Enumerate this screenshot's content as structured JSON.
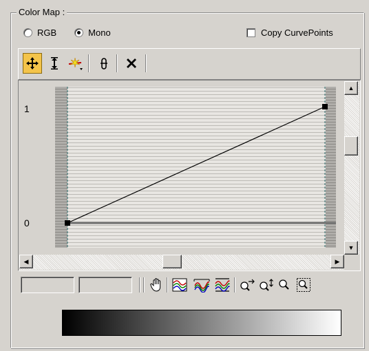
{
  "group": {
    "title": "Color Map :"
  },
  "mode": {
    "options": [
      {
        "label": "RGB",
        "selected": false
      },
      {
        "label": "Mono",
        "selected": true
      }
    ]
  },
  "copy_curve_points": {
    "label": "Copy CurvePoints",
    "checked": false
  },
  "toolbar": {
    "tools": [
      "move-icon",
      "scale-vertical-icon",
      "insert-point-icon",
      "reset-curves-icon",
      "delete-point-icon"
    ],
    "active": "move-icon"
  },
  "graph": {
    "y_labels": [
      "1",
      "0"
    ],
    "curve_points": [
      {
        "x": 0,
        "y": 0
      },
      {
        "x": 1,
        "y": 1
      }
    ]
  },
  "bottom_toolbar": {
    "point_x_value": "",
    "point_y_value": "",
    "tools": [
      "pan-icon",
      "zoom-extents-icon",
      "zoom-horizontal-extents-icon",
      "zoom-value-extents-icon",
      "zoom-horizontally-icon",
      "zoom-vertically-icon",
      "zoom-icon",
      "zoom-region-icon"
    ]
  },
  "gradient": {
    "from": "#000000",
    "to": "#ffffff"
  },
  "colors": {
    "active_tool": "#f4c44a",
    "panel": "#d6d3ce",
    "curve_red": "#c00000",
    "curve_green": "#008000",
    "curve_blue": "#0000c0"
  }
}
